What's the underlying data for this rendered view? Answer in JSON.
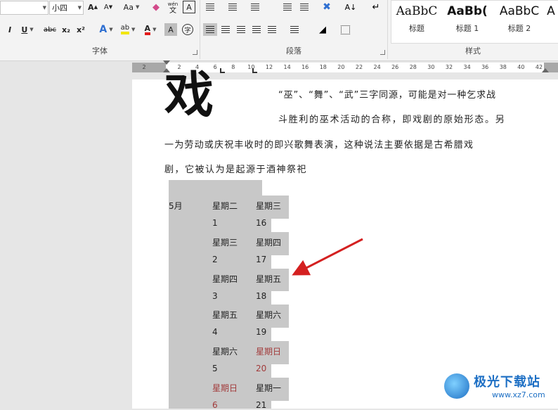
{
  "ribbon": {
    "font_group": {
      "label": "字体",
      "size_value": "小四",
      "grow_font": "A",
      "shrink_font": "A",
      "change_case": "Aa",
      "phonetic_top": "wén",
      "phonetic_bottom": "文",
      "char_border": "A",
      "italic": "I",
      "underline": "U",
      "strikethrough": "abc",
      "subscript": "x₂",
      "superscript": "x²",
      "text_effect": "A",
      "highlight": "ab",
      "font_color": "A",
      "char_shading": "A",
      "enclose_char": "字"
    },
    "paragraph_group": {
      "label": "段落"
    },
    "styles_group": {
      "label": "样式",
      "items": [
        {
          "sample": "AaBbC",
          "name": "标题"
        },
        {
          "sample": "AaBb(",
          "name": "标题 1"
        },
        {
          "sample": "AaBbC",
          "name": "标题 2"
        },
        {
          "sample": "A",
          "name": ""
        }
      ]
    }
  },
  "ruler": {
    "ticks": [
      "2",
      "2",
      "4",
      "6",
      "8",
      "10",
      "12",
      "14",
      "16",
      "18",
      "20",
      "22",
      "24",
      "26",
      "28",
      "30",
      "32",
      "34",
      "36",
      "38",
      "40",
      "42"
    ]
  },
  "document": {
    "big_char": "戏",
    "lines": [
      "“巫”、“舞”、“武”三字同源，可能是对一种乞求战",
      "斗胜利的巫术活动的合称，即戏剧的原始形态。另",
      "一为劳动或庆祝丰收时的即兴歌舞表演，这种说法主要依据是古希腊戏",
      "剧，它被认为是起源于酒神祭祀"
    ],
    "month": "5月",
    "column_a": [
      "星期二",
      "1",
      "星期三",
      "2",
      "星期四",
      "3",
      "星期五",
      "4",
      "星期六",
      "5",
      "星期日",
      "6"
    ],
    "column_b": [
      "星期三",
      "16",
      "星期四",
      "17",
      "星期五",
      "18",
      "星期六",
      "19",
      "星期日",
      "20",
      "星期一",
      "21"
    ],
    "red_a": [
      10,
      11
    ],
    "red_b": [
      8,
      9
    ]
  },
  "watermark": {
    "title": "极光下载站",
    "url": "www.xz7.com"
  },
  "colors": {
    "shade": "#c8c8c8",
    "red_text": "#a23b3b",
    "arrow": "#d42020",
    "watermark_blue": "#1d6fc4"
  }
}
